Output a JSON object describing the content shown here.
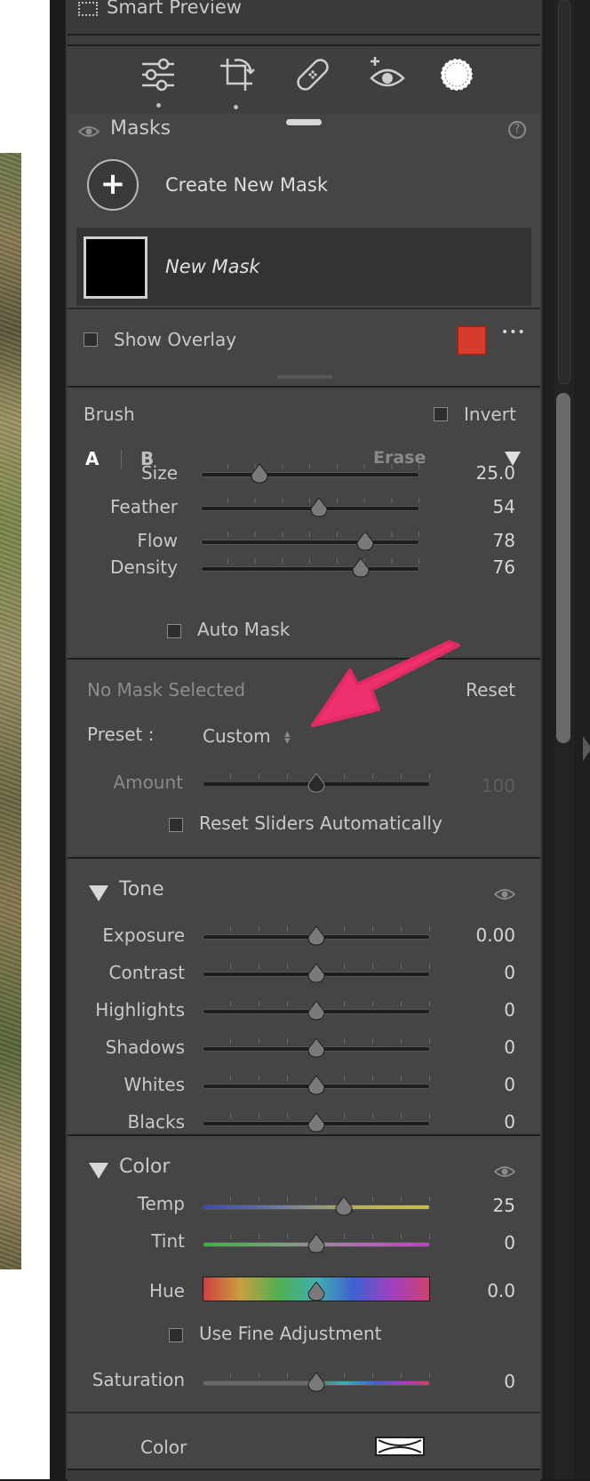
{
  "smart_preview": {
    "label": "Smart Preview"
  },
  "toolstrip": {
    "icons": [
      "sliders-icon",
      "crop-icon",
      "healing-icon",
      "red-eye-icon",
      "masking-icon"
    ]
  },
  "masks": {
    "title": "Masks",
    "help": "?",
    "create_label": "Create New Mask",
    "create_symbol": "+",
    "new_mask_label": "New Mask",
    "show_overlay_label": "Show Overlay",
    "overlay_color": "#d63b2b",
    "more": "•••"
  },
  "brush": {
    "title": "Brush",
    "invert_label": "Invert",
    "tab_a": "A",
    "tab_b": "B",
    "erase_label": "Erase",
    "sliders": [
      {
        "label": "Size",
        "value": "25.0",
        "pos": 0.27
      },
      {
        "label": "Feather",
        "value": "54",
        "pos": 0.54
      },
      {
        "label": "Flow",
        "value": "78",
        "pos": 0.75
      },
      {
        "label": "Density",
        "value": "76",
        "pos": 0.73
      }
    ],
    "auto_mask_label": "Auto Mask"
  },
  "preset_section": {
    "status": "No Mask Selected",
    "reset_label": "Reset",
    "preset_label": "Preset :",
    "preset_value": "Custom",
    "amount_label": "Amount",
    "amount_value": "100",
    "reset_sliders_label": "Reset Sliders Automatically"
  },
  "tone": {
    "title": "Tone",
    "sliders": [
      {
        "label": "Exposure",
        "value": "0.00"
      },
      {
        "label": "Contrast",
        "value": "0"
      },
      {
        "label": "Highlights",
        "value": "0"
      },
      {
        "label": "Shadows",
        "value": "0"
      },
      {
        "label": "Whites",
        "value": "0"
      },
      {
        "label": "Blacks",
        "value": "0"
      }
    ]
  },
  "color": {
    "title": "Color",
    "temp_label": "Temp",
    "temp_value": "25",
    "tint_label": "Tint",
    "tint_value": "0",
    "hue_label": "Hue",
    "hue_value": "0.0",
    "fine_adjust_label": "Use Fine Adjustment",
    "saturation_label": "Saturation",
    "saturation_value": "0",
    "color_label": "Color"
  }
}
